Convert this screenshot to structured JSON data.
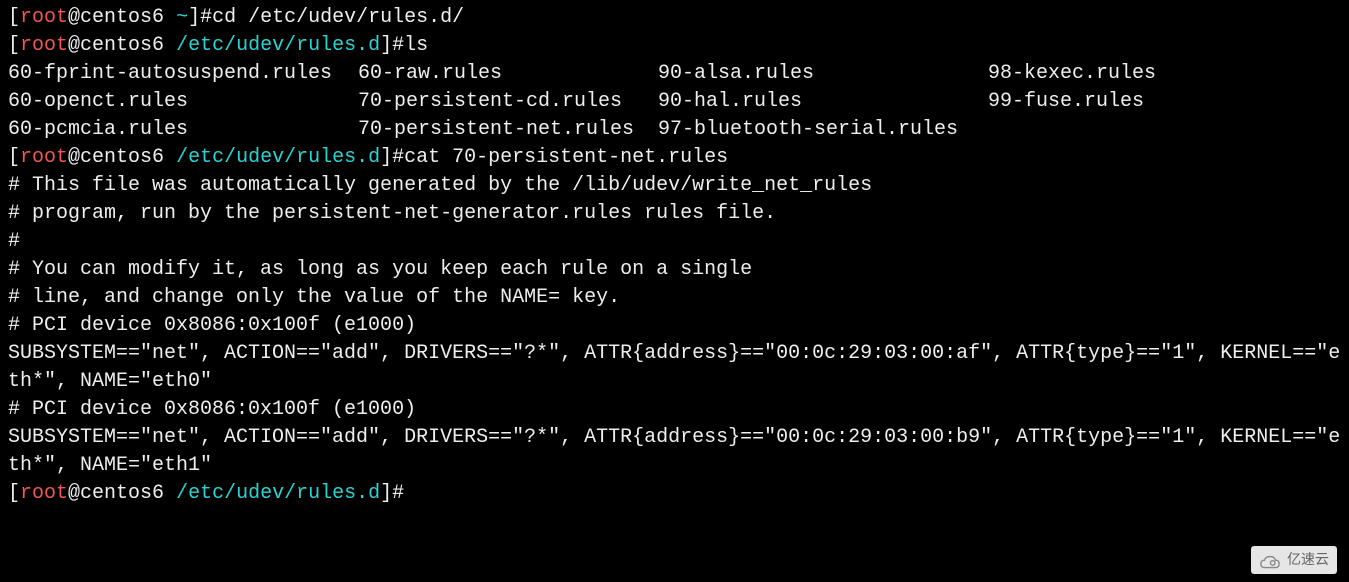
{
  "terminal": {
    "prompt1": {
      "open": "[",
      "user": "root",
      "sep": "@",
      "host": "centos6",
      "path": " ~",
      "close": "]#",
      "cmd": "cd /etc/udev/rules.d/"
    },
    "prompt2": {
      "open": "[",
      "user": "root",
      "sep": "@",
      "host": "centos6",
      "path": " /etc/udev/rules.d",
      "close": "]#",
      "cmd": "ls"
    },
    "ls_output": {
      "col1": [
        "60-fprint-autosuspend.rules",
        "60-openct.rules",
        "60-pcmcia.rules"
      ],
      "col2": [
        "60-raw.rules",
        "70-persistent-cd.rules",
        "70-persistent-net.rules"
      ],
      "col3": [
        "90-alsa.rules",
        "90-hal.rules",
        "97-bluetooth-serial.rules"
      ],
      "col4": [
        "98-kexec.rules",
        "99-fuse.rules",
        ""
      ]
    },
    "prompt3": {
      "open": "[",
      "user": "root",
      "sep": "@",
      "host": "centos6",
      "path": " /etc/udev/rules.d",
      "close": "]#",
      "cmd": "cat 70-persistent-net.rules"
    },
    "cat_output": [
      "# This file was automatically generated by the /lib/udev/write_net_rules",
      "# program, run by the persistent-net-generator.rules rules file.",
      "#",
      "# You can modify it, as long as you keep each rule on a single",
      "# line, and change only the value of the NAME= key.",
      "",
      "# PCI device 0x8086:0x100f (e1000)",
      "SUBSYSTEM==\"net\", ACTION==\"add\", DRIVERS==\"?*\", ATTR{address}==\"00:0c:29:03:00:af\", ATTR{type}==\"1\", KERNEL==\"eth*\", NAME=\"eth0\"",
      "",
      "# PCI device 0x8086:0x100f (e1000)",
      "SUBSYSTEM==\"net\", ACTION==\"add\", DRIVERS==\"?*\", ATTR{address}==\"00:0c:29:03:00:b9\", ATTR{type}==\"1\", KERNEL==\"eth*\", NAME=\"eth1\""
    ],
    "prompt4": {
      "open": "[",
      "user": "root",
      "sep": "@",
      "host": "centos6",
      "path": " /etc/udev/rules.d",
      "close": "]#"
    },
    "watermark": "亿速云"
  }
}
